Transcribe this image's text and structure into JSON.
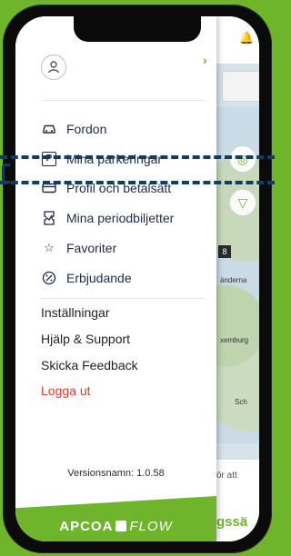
{
  "drawer": {
    "menu": [
      {
        "label": "Fordon",
        "icon": "car-icon"
      },
      {
        "label": "Mina parkeringar",
        "icon": "parking-icon"
      },
      {
        "label": "Profil och betalsätt",
        "icon": "credit-card-icon"
      },
      {
        "label": "Mina periodbiljetter",
        "icon": "ticket-icon"
      },
      {
        "label": "Favoriter",
        "icon": "star-icon"
      },
      {
        "label": "Erbjudande",
        "icon": "discount-icon"
      }
    ],
    "settings": "Inställningar",
    "help": "Hjälp & Support",
    "feedback": "Skicka Feedback",
    "logout": "Logga ut",
    "version": "Versionsnamn: 1.0.58",
    "brand_bold": "APCOA",
    "brand_light": "FLOW"
  },
  "map": {
    "badge": "8",
    "labels": [
      "änderna",
      "xemburg",
      "Sch"
    ],
    "bottom_text": "ör att",
    "bottom_partial": "gssä"
  },
  "colors": {
    "accent": "#6fb52c",
    "logout": "#e23a2b",
    "menu_text": "#1f2a4d",
    "highlight": "#123d63"
  }
}
